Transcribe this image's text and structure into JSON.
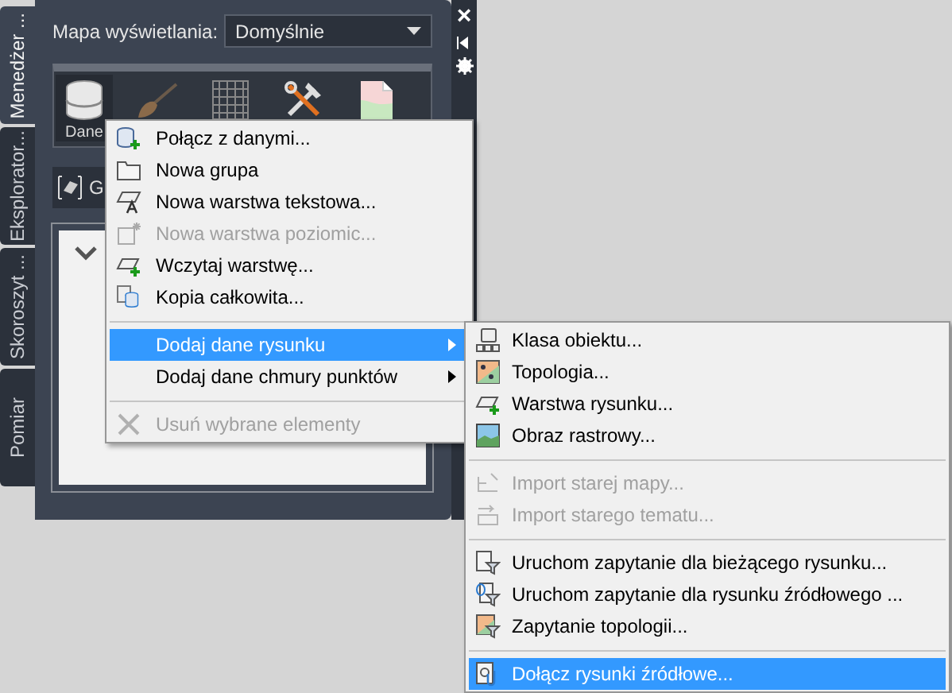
{
  "side_tabs": [
    {
      "label": "Menedżer ...",
      "selected": true
    },
    {
      "label": "Eksplorator...",
      "selected": false
    },
    {
      "label": "Skoroszyt ...",
      "selected": false
    },
    {
      "label": "Pomiar",
      "selected": false
    }
  ],
  "window_buttons": [
    "×"
  ],
  "display_map": {
    "label": "Mapa wyświetlania:",
    "value": "Domyślnie"
  },
  "toolbar": [
    {
      "label": "Dane",
      "selected": true
    },
    {
      "selected": false
    },
    {
      "selected": false
    },
    {
      "selected": false
    },
    {
      "selected": false
    }
  ],
  "view_bar": {
    "label": "G"
  },
  "context_menu": [
    {
      "kind": "item",
      "label": "Połącz z danymi...",
      "disabled": false,
      "selected": false,
      "submenu": false
    },
    {
      "kind": "item",
      "label": "Nowa grupa",
      "disabled": false,
      "selected": false,
      "submenu": false
    },
    {
      "kind": "item",
      "label": "Nowa warstwa tekstowa...",
      "disabled": false,
      "selected": false,
      "submenu": false
    },
    {
      "kind": "item",
      "label": "Nowa warstwa poziomic...",
      "disabled": true,
      "selected": false,
      "submenu": false
    },
    {
      "kind": "item",
      "label": "Wczytaj warstwę...",
      "disabled": false,
      "selected": false,
      "submenu": false
    },
    {
      "kind": "item",
      "label": "Kopia całkowita...",
      "disabled": false,
      "selected": false,
      "submenu": false
    },
    {
      "kind": "separator"
    },
    {
      "kind": "item",
      "label": "Dodaj dane rysunku",
      "disabled": false,
      "selected": true,
      "submenu": true
    },
    {
      "kind": "item",
      "label": "Dodaj dane chmury punktów",
      "disabled": false,
      "selected": false,
      "submenu": true
    },
    {
      "kind": "separator"
    },
    {
      "kind": "item",
      "label": "Usuń wybrane elementy",
      "disabled": true,
      "selected": false,
      "submenu": false
    }
  ],
  "submenu": [
    {
      "kind": "item",
      "label": "Klasa obiektu...",
      "disabled": false,
      "selected": false
    },
    {
      "kind": "item",
      "label": "Topologia...",
      "disabled": false,
      "selected": false
    },
    {
      "kind": "item",
      "label": "Warstwa rysunku...",
      "disabled": false,
      "selected": false
    },
    {
      "kind": "item",
      "label": "Obraz rastrowy...",
      "disabled": false,
      "selected": false
    },
    {
      "kind": "separator"
    },
    {
      "kind": "item",
      "label": "Import starej mapy...",
      "disabled": true,
      "selected": false
    },
    {
      "kind": "item",
      "label": "Import starego tematu...",
      "disabled": true,
      "selected": false
    },
    {
      "kind": "separator"
    },
    {
      "kind": "item",
      "label": "Uruchom zapytanie dla bieżącego rysunku...",
      "disabled": false,
      "selected": false
    },
    {
      "kind": "item",
      "label": "Uruchom zapytanie dla rysunku źródłowego ...",
      "disabled": false,
      "selected": false
    },
    {
      "kind": "item",
      "label": "Zapytanie topologii...",
      "disabled": false,
      "selected": false
    },
    {
      "kind": "separator"
    },
    {
      "kind": "item",
      "label": "Dołącz rysunki źródłowe...",
      "disabled": false,
      "selected": true
    }
  ]
}
